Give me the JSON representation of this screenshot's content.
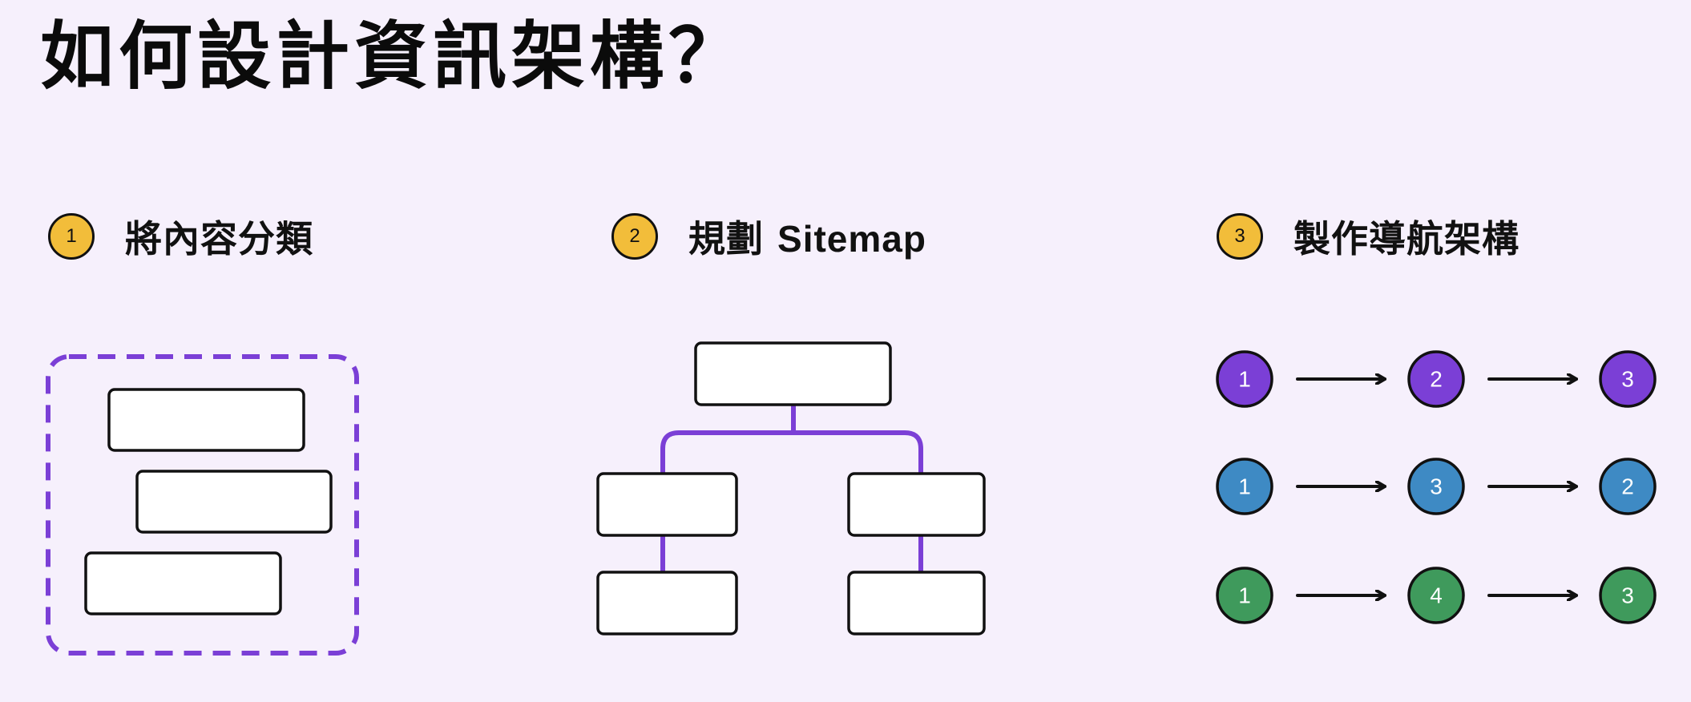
{
  "title": "如何設計資訊架構？",
  "steps": [
    {
      "number": "1",
      "label": "將內容分類"
    },
    {
      "number": "2",
      "label_cjk": "規劃",
      "label_latin": "Sitemap"
    },
    {
      "number": "3",
      "label": "製作導航架構"
    }
  ],
  "colors": {
    "background": "#f6f0fc",
    "badge": "#f2bd3a",
    "accent_purple": "#7b3fd6",
    "flow_blue": "#3e8ac4",
    "flow_green": "#3f9a5c"
  },
  "navigation_flows": [
    {
      "color": "#7b3fd6",
      "nodes": [
        "1",
        "2",
        "3"
      ]
    },
    {
      "color": "#3e8ac4",
      "nodes": [
        "1",
        "3",
        "2"
      ]
    },
    {
      "color": "#3f9a5c",
      "nodes": [
        "1",
        "4",
        "3"
      ]
    }
  ]
}
